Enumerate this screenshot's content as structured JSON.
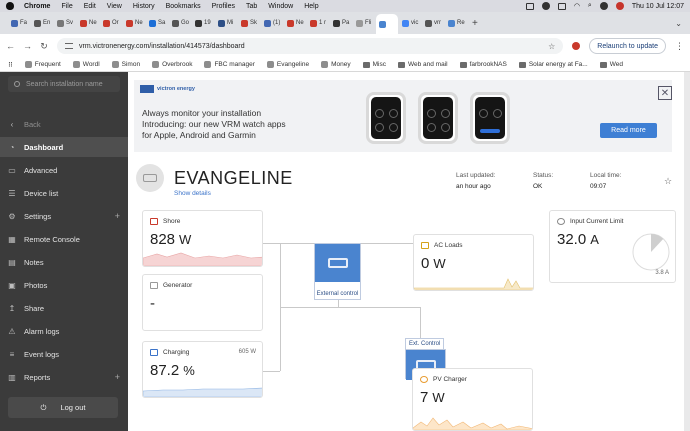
{
  "menubar": {
    "app": "Chrome",
    "items": [
      "File",
      "Edit",
      "View",
      "History",
      "Bookmarks",
      "Profiles",
      "Tab",
      "Window",
      "Help"
    ],
    "clock": "Thu 10 Jul  12:07"
  },
  "tabs": [
    {
      "label": "Fa",
      "color": "#4267b2"
    },
    {
      "label": "En",
      "color": "#555555"
    },
    {
      "label": "Sv",
      "color": "#777777"
    },
    {
      "label": "Ne",
      "color": "#c9392b"
    },
    {
      "label": "Or",
      "color": "#c9392b"
    },
    {
      "label": "Ne",
      "color": "#c9392b"
    },
    {
      "label": "Sa",
      "color": "#1c6ed6"
    },
    {
      "label": "Go",
      "color": "#555555"
    },
    {
      "label": "19",
      "color": "#333333"
    },
    {
      "label": "Mi",
      "color": "#2d4f86"
    },
    {
      "label": "Sk",
      "color": "#c9392b"
    },
    {
      "label": "(1)",
      "color": "#4267b2"
    },
    {
      "label": "Ne",
      "color": "#c9392b"
    },
    {
      "label": "1 r",
      "color": "#c9392b"
    },
    {
      "label": "Pa",
      "color": "#333333"
    },
    {
      "label": "Fli",
      "color": "#999999"
    },
    {
      "label": "",
      "color": "#4a84cf",
      "active": true
    },
    {
      "label": "vic",
      "color": "#4285f4"
    },
    {
      "label": "vrr",
      "color": "#555555"
    },
    {
      "label": "Re",
      "color": "#4a84cf"
    }
  ],
  "address": {
    "url": "vrm.victronenergy.com/installation/414573/dashboard",
    "relaunch": "Relaunch to update"
  },
  "bookmarks": [
    "Frequent",
    "Wordl",
    "Simon",
    "Overbrook",
    "FBC manager",
    "Evangeline",
    "Money",
    "Misc",
    "Web and mail",
    "farbrookNAS",
    "Solar energy at Fa...",
    "Wed"
  ],
  "sidebar": {
    "search_placeholder": "Search installation name",
    "items": [
      {
        "label": "Back",
        "icon": "chevron-left-icon",
        "glyph": "‹"
      },
      {
        "label": "Dashboard",
        "icon": "dashboard-icon",
        "glyph": "◔",
        "active": true
      },
      {
        "label": "Advanced",
        "icon": "advanced-icon",
        "glyph": "▭"
      },
      {
        "label": "Device list",
        "icon": "device-list-icon",
        "glyph": "☰"
      },
      {
        "label": "Settings",
        "icon": "gear-icon",
        "glyph": "⚙",
        "plus": true
      },
      {
        "label": "Remote Console",
        "icon": "remote-console-icon",
        "glyph": "▦"
      },
      {
        "label": "Notes",
        "icon": "notes-icon",
        "glyph": "▤"
      },
      {
        "label": "Photos",
        "icon": "photos-icon",
        "glyph": "▣"
      },
      {
        "label": "Share",
        "icon": "share-icon",
        "glyph": "↥"
      },
      {
        "label": "Alarm logs",
        "icon": "alarm-icon",
        "glyph": "⚠"
      },
      {
        "label": "Event logs",
        "icon": "event-icon",
        "glyph": "≡"
      },
      {
        "label": "Reports",
        "icon": "reports-icon",
        "glyph": "▥",
        "plus": true
      }
    ],
    "logout": "Log out"
  },
  "banner": {
    "brand": "victron energy",
    "line1": "Always monitor your installation",
    "line2": "Introducing: our new VRM watch apps",
    "line3": "for Apple, Android and Garmin",
    "read_more": "Read more"
  },
  "site": {
    "name": "EVANGELINE",
    "show_details": "Show details",
    "last_updated_label": "Last updated:",
    "last_updated": "an hour ago",
    "status_label": "Status:",
    "status": "OK",
    "local_time_label": "Local time:",
    "local_time": "09:07"
  },
  "cards": {
    "shore": {
      "title": "Shore",
      "value": "828",
      "unit": "W"
    },
    "generator": {
      "title": "Generator",
      "value": "-"
    },
    "charging": {
      "title": "Charging",
      "value": "87.2",
      "unit": "%",
      "extra": "605 W"
    },
    "ac_loads": {
      "title": "AC Loads",
      "value": "0",
      "unit": "W"
    },
    "pv_charger": {
      "title": "PV Charger",
      "value": "7",
      "unit": "W"
    },
    "input_limit": {
      "title": "Input Current Limit",
      "value": "32.0",
      "unit": "A",
      "gauge_label": "3.8 A",
      "gauge_fraction": 0.12
    }
  },
  "hub": {
    "label": "External control"
  },
  "ext_control": {
    "label": "Ext. Control"
  },
  "colors": {
    "accent": "#4a84cf",
    "shore_fill": "#f6d4d4",
    "charge_fill": "#dbe7f6",
    "pv_fill": "#fde6c9",
    "loads_fill": "#f7e9c8"
  }
}
